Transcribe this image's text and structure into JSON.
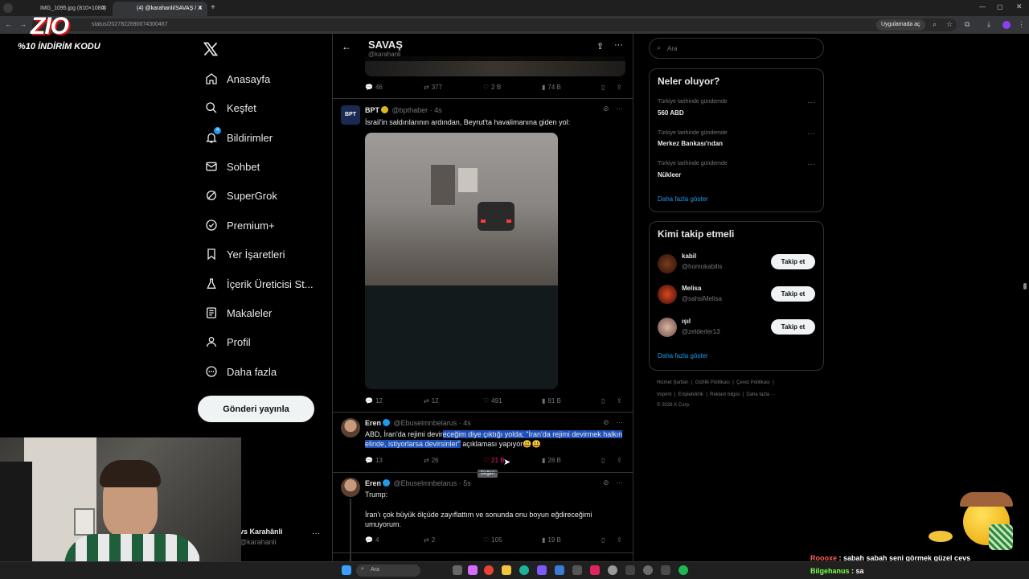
{
  "browser": {
    "tabs": [
      {
        "label": "IMG_1095.jpg (810×1080)",
        "active": false
      },
      {
        "label": "(4) @karahanli/SAVAŞ / X",
        "active": true
      }
    ],
    "url": "status/2027822690074300467",
    "app_button": "Uygulamada aç"
  },
  "overlay": {
    "logo_text": "ZIO",
    "promo": "%10 İNDİRİM KODU"
  },
  "nav": {
    "items": [
      {
        "label": "Anasayfa",
        "icon": "home-icon"
      },
      {
        "label": "Keşfet",
        "icon": "search-icon"
      },
      {
        "label": "Bildirimler",
        "icon": "bell-icon",
        "badge": "4"
      },
      {
        "label": "Sohbet",
        "icon": "mail-icon"
      },
      {
        "label": "SuperGrok",
        "icon": "grok-icon"
      },
      {
        "label": "Premium+",
        "icon": "verified-icon"
      },
      {
        "label": "Yer İşaretleri",
        "icon": "bookmark-icon"
      },
      {
        "label": "İçerik Üreticisi St...",
        "icon": "flask-icon"
      },
      {
        "label": "Makaleler",
        "icon": "article-icon"
      },
      {
        "label": "Profil",
        "icon": "person-icon"
      },
      {
        "label": "Daha fazla",
        "icon": "more-circle-icon"
      }
    ],
    "post_button": "Gönderi yayınla",
    "account_name": "vs Karahânli",
    "account_handle": "@karahanli"
  },
  "header": {
    "title": "SAVAŞ",
    "handle": "@karahanli"
  },
  "tweets": [
    {
      "stats": {
        "replies": "46",
        "reposts": "377",
        "likes": "2 B",
        "views": "74 B"
      }
    },
    {
      "name": "BPT",
      "handle": "@bpthaber",
      "time": "· 4s",
      "text": "İsrail'in saldırılarının ardından, Beyrut'ta havalimanına giden yol:",
      "stats": {
        "replies": "12",
        "reposts": "12",
        "likes": "491",
        "views": "81 B"
      }
    },
    {
      "name": "Eren",
      "handle": "@Ebuselmnbelarus",
      "time": "· 4s",
      "text_plain": "ABD, İran'da rejimi devir",
      "text_selected": "eceğim diye çıktığı yolda; \"İran'da rejimi devirmek halkın elinde, istiyorlarsa devirsinler\"",
      "text_after": " açıklaması yapıyor😃😃",
      "stats": {
        "replies": "13",
        "reposts": "26",
        "likes": "21 B",
        "views": "28 B"
      },
      "tooltip": "Beğen"
    },
    {
      "name": "Eren",
      "handle": "@Ebuselmnbelarus",
      "time": "· 5s",
      "line1": "Trump:",
      "line2": "İran'ı çok büyük ölçüde zayıflattım ve sonunda onu boyun eğdireceğimi umuyorum.",
      "stats": {
        "replies": "4",
        "reposts": "2",
        "likes": "105",
        "views": "19 B"
      }
    }
  ],
  "search": {
    "placeholder": "Ara"
  },
  "trends": {
    "title": "Neler oluyor?",
    "items": [
      {
        "context": "Türkiye tarihinde gündemde",
        "name": "560 ABD"
      },
      {
        "context": "Türkiye tarihinde gündemde",
        "name": "Merkez Bankası'ndan"
      },
      {
        "context": "Türkiye tarihinde gündemde",
        "name": "Nükleer"
      }
    ],
    "more": "Daha fazla göster"
  },
  "who_to_follow": {
    "title": "Kimi takip etmeli",
    "items": [
      {
        "name": "kabil",
        "handle": "@homokabilis",
        "button": "Takip et"
      },
      {
        "name": "Melisa",
        "handle": "@sahsiMelisa",
        "button": "Takip et"
      },
      {
        "name": "ışıl",
        "handle": "@zelderler13",
        "button": "Takip et"
      }
    ],
    "more": "Daha fazla göster"
  },
  "footer": {
    "line1": [
      "Hizmet Şartları",
      "Gizlilik Politikası",
      "Çerez Politikası"
    ],
    "line2": [
      "Imprint",
      "Erişilebilirlik",
      "Reklam bilgisi",
      "Daha fazla ···"
    ],
    "copyright": "© 2026 X Corp."
  },
  "taskbar": {
    "search": "Ara"
  },
  "chat": [
    {
      "user": "Roooxe",
      "message": "sabah sabah seni görmek güzel cevs",
      "color": "#ff5e5e"
    },
    {
      "user": "Bilgehanus",
      "message": "sa",
      "color": "#7cff4f"
    }
  ],
  "colors": {
    "accent": "#1d9bf0",
    "like_active": "#f91880",
    "selection": "#1d4fb8"
  }
}
